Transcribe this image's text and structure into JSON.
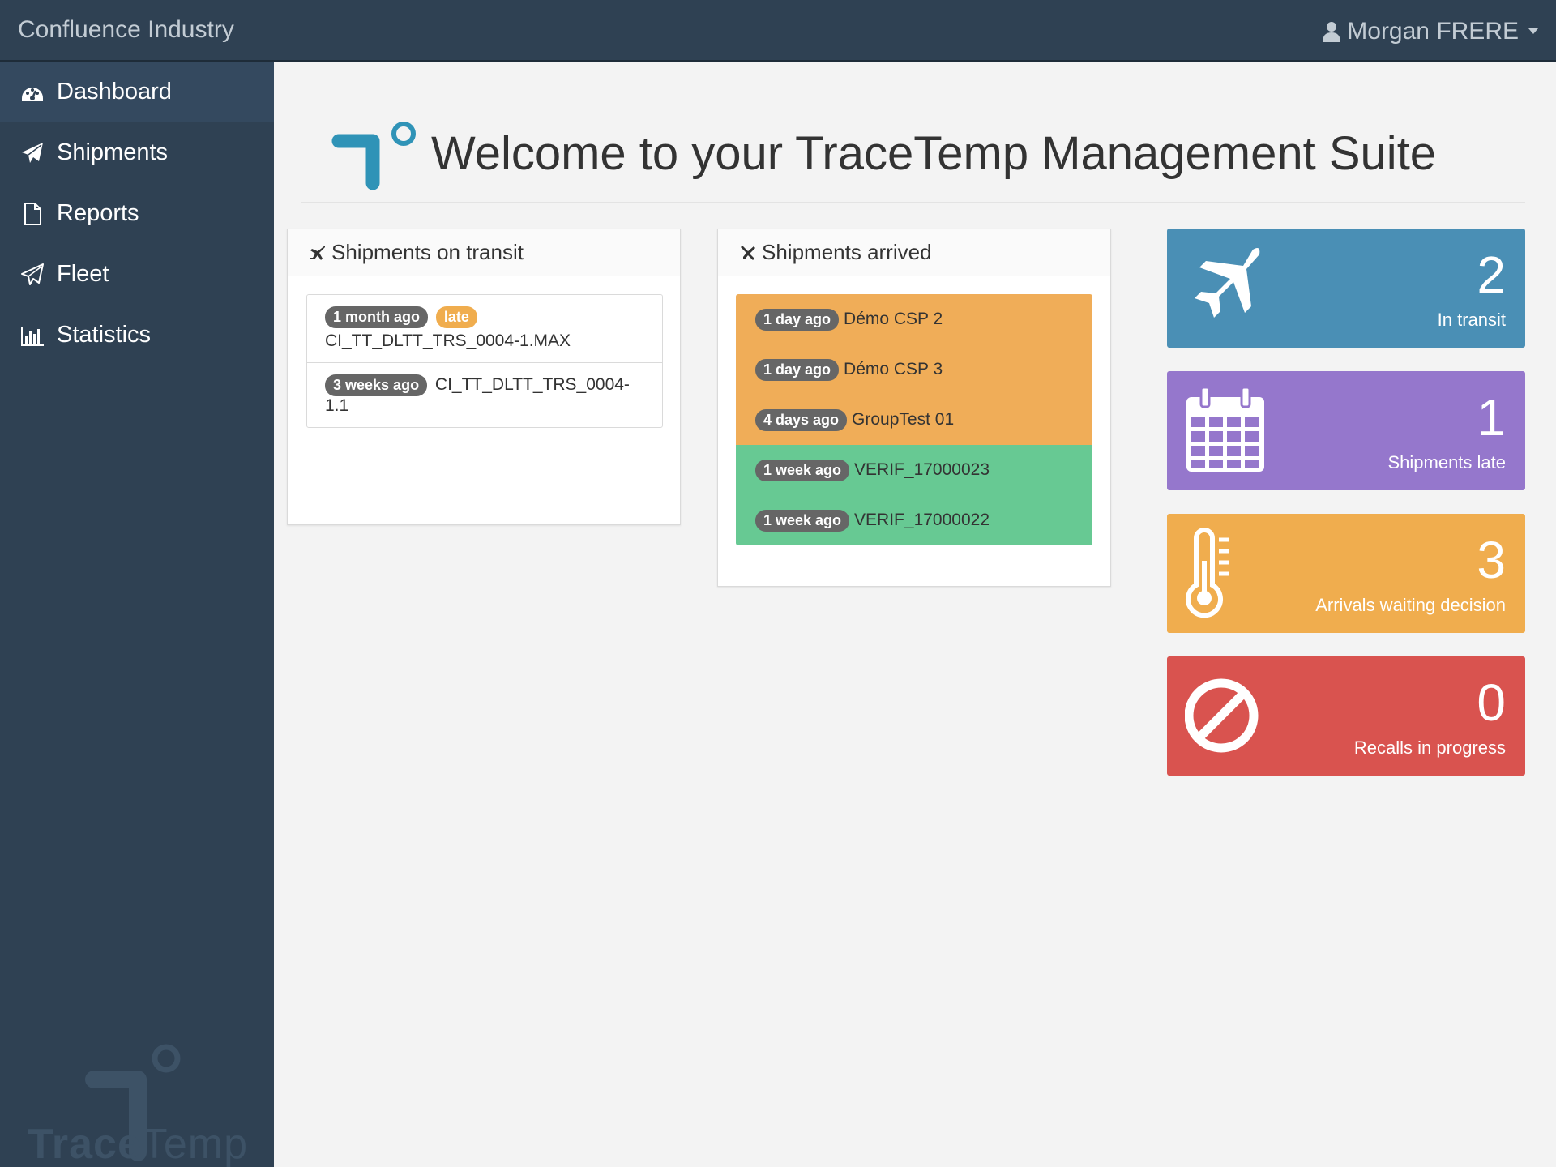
{
  "app": {
    "brand": "Confluence Industry",
    "user": "Morgan FRERE"
  },
  "sidebar": {
    "items": [
      {
        "label": "Dashboard",
        "icon": "dashboard-icon"
      },
      {
        "label": "Shipments",
        "icon": "send-icon"
      },
      {
        "label": "Reports",
        "icon": "file-icon"
      },
      {
        "label": "Fleet",
        "icon": "paper-plane-icon"
      },
      {
        "label": "Statistics",
        "icon": "bar-chart-icon"
      }
    ],
    "logo_word_a": "Trace",
    "logo_word_b": "Temp"
  },
  "header": {
    "title": "Welcome to your TraceTemp Management Suite"
  },
  "transit": {
    "title": "Shipments on transit",
    "items": [
      {
        "age": "1 month ago",
        "flag": "late",
        "name": "CI_TT_DLTT_TRS_0004-1.MAX"
      },
      {
        "age": "3 weeks ago",
        "name": "CI_TT_DLTT_TRS_0004-1.1"
      }
    ]
  },
  "arrived": {
    "title": "Shipments arrived",
    "items": [
      {
        "age": "1 day ago",
        "name": "Démo CSP 2"
      },
      {
        "age": "1 day ago",
        "name": "Démo CSP 3"
      },
      {
        "age": "4 days ago",
        "name": "GroupTest 01"
      },
      {
        "age": "1 week ago",
        "name": "VERIF_17000023"
      },
      {
        "age": "1 week ago",
        "name": "VERIF_17000022"
      }
    ]
  },
  "stats": [
    {
      "value": "2",
      "label": "In transit",
      "color": "#4a8fb5",
      "icon": "plane-icon"
    },
    {
      "value": "1",
      "label": "Shipments late",
      "color": "#9577cc",
      "icon": "calendar-icon"
    },
    {
      "value": "3",
      "label": "Arrivals waiting decision",
      "color": "#f0ad4e",
      "icon": "thermometer-icon"
    },
    {
      "value": "0",
      "label": "Recalls in progress",
      "color": "#d9534f",
      "icon": "ban-icon"
    }
  ],
  "colors": {
    "sidebar": "#2f4153",
    "arrived_pending": "#f0ad58",
    "arrived_ok": "#67c993",
    "badge": "#666666",
    "late": "#f0ad4e"
  }
}
